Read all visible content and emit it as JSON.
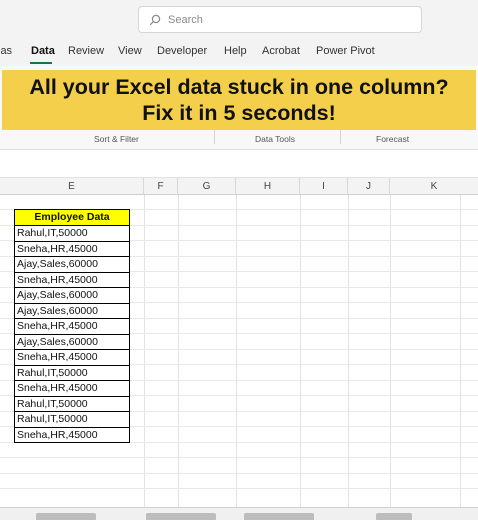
{
  "search": {
    "placeholder": "Search"
  },
  "ribbon": {
    "tabs": [
      {
        "label": "las"
      },
      {
        "label": "Data"
      },
      {
        "label": "Review"
      },
      {
        "label": "View"
      },
      {
        "label": "Developer"
      },
      {
        "label": "Help"
      },
      {
        "label": "Acrobat"
      },
      {
        "label": "Power Pivot"
      }
    ],
    "active_tab": "Data",
    "groups": [
      {
        "label": "Sort & Filter"
      },
      {
        "label": "Data Tools"
      },
      {
        "label": "Forecast"
      }
    ]
  },
  "banner": {
    "line1": "All your Excel data stuck in one column?",
    "line2": "Fix it in 5 seconds!"
  },
  "columns": [
    "E",
    "F",
    "G",
    "H",
    "I",
    "J",
    "K"
  ],
  "table": {
    "header": "Employee Data",
    "rows": [
      "Rahul,IT,50000",
      "Sneha,HR,45000",
      "Ajay,Sales,60000",
      "Sneha,HR,45000",
      "Ajay,Sales,60000",
      "Ajay,Sales,60000",
      "Sneha,HR,45000",
      "Ajay,Sales,60000",
      "Sneha,HR,45000",
      "Rahul,IT,50000",
      "Sneha,HR,45000",
      "Rahul,IT,50000",
      "Rahul,IT,50000",
      "Sneha,HR,45000"
    ]
  },
  "colors": {
    "banner_bg": "#f3cf4b",
    "header_fill": "#ffff00",
    "accent": "#1e7145"
  }
}
